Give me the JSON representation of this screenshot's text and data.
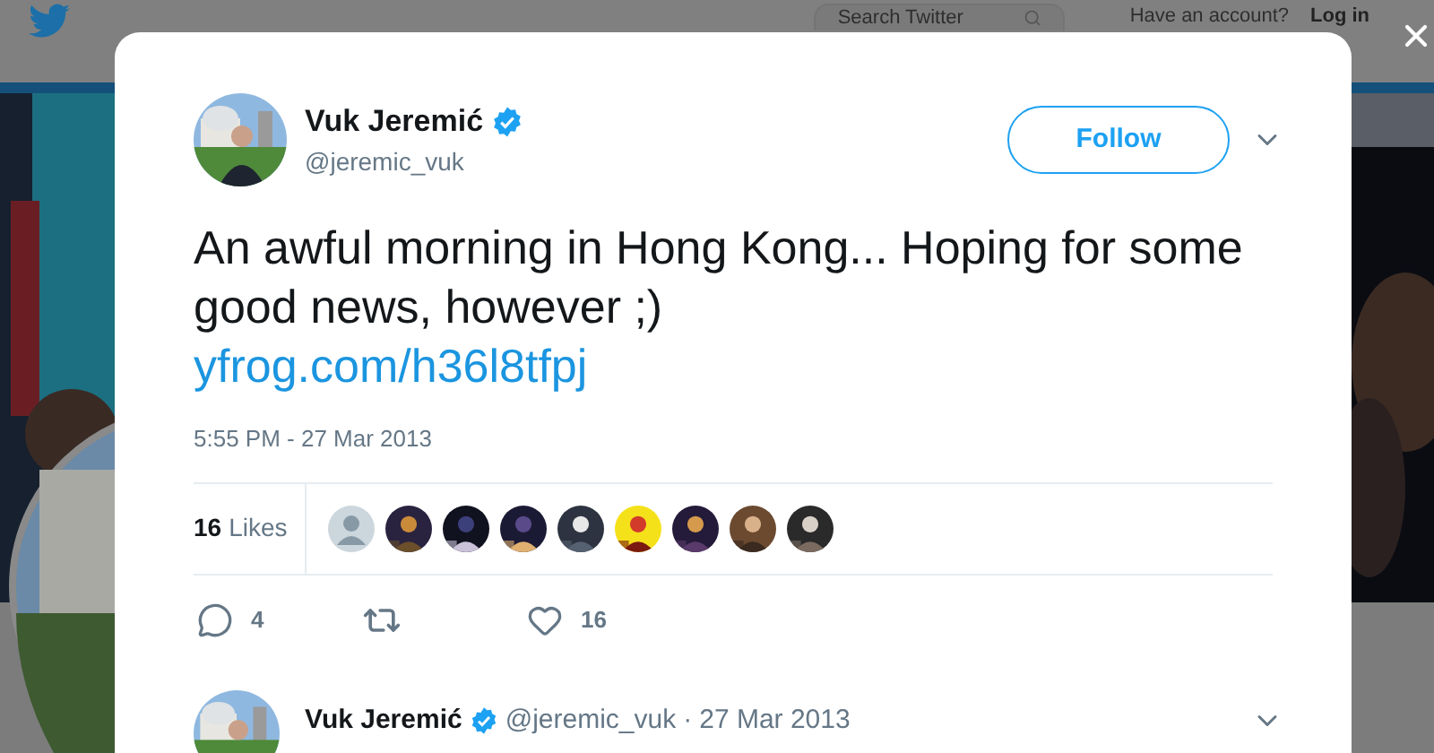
{
  "header": {
    "search_placeholder": "Search Twitter",
    "account_prompt": "Have an account?",
    "login": "Log in"
  },
  "tweet": {
    "author": {
      "name": "Vuk Jeremić",
      "handle": "@jeremic_vuk",
      "verified": true
    },
    "follow": "Follow",
    "text": "An awful morning in Hong Kong... Hoping for some good news, however ;)",
    "link": "yfrog.com/h36l8tfpj",
    "timestamp": "5:55 PM - 27 Mar 2013",
    "likes": {
      "count": "16",
      "label": "Likes",
      "likers": [
        {
          "kind": "default"
        },
        {
          "kind": "picture"
        },
        {
          "kind": "picture"
        },
        {
          "kind": "picture"
        },
        {
          "kind": "picture"
        },
        {
          "kind": "picture"
        },
        {
          "kind": "picture"
        },
        {
          "kind": "picture"
        },
        {
          "kind": "picture"
        }
      ]
    },
    "actions": [
      {
        "kind": "reply",
        "count": "4"
      },
      {
        "kind": "retweet"
      },
      {
        "kind": "like",
        "count": "16"
      }
    ]
  },
  "reply": {
    "name": "Vuk Jeremić",
    "verified": true,
    "handle": "@jeremic_vuk",
    "separator": "·",
    "date": "27 Mar 2013"
  }
}
